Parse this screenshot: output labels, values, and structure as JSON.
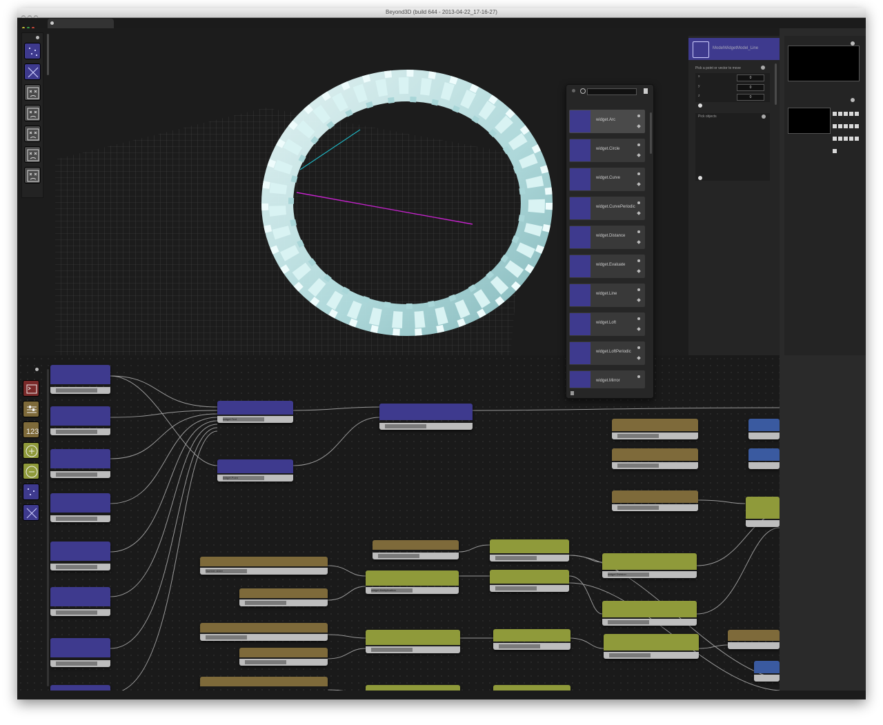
{
  "window": {
    "title": "Beyond3D (build 644 - 2013-04-22_17-16-27)"
  },
  "viewport": {
    "tools": [
      "points-tool-icon",
      "line-tool-icon",
      "widget-icon",
      "widget-icon",
      "widget-icon",
      "widget-icon",
      "widget-icon"
    ]
  },
  "widget_list": {
    "items": [
      {
        "label": "widget.Arc"
      },
      {
        "label": "widget.Circle"
      },
      {
        "label": "widget.Curve"
      },
      {
        "label": "widget.CurvePeriodic"
      },
      {
        "label": "widget.Distance"
      },
      {
        "label": "widget.Evaluate"
      },
      {
        "label": "widget.Line"
      },
      {
        "label": "widget.Loft"
      },
      {
        "label": "widget.LoftPeriodic"
      },
      {
        "label": "widget.Mirror"
      }
    ]
  },
  "inspector": {
    "title": "ModelWidgetModel_Line",
    "pick_point_label": "Pick a point or vector to move",
    "axes": [
      "x",
      "y",
      "z"
    ],
    "axis_values": [
      "0",
      "0",
      "0"
    ],
    "pick_objects_label": "Pick objects"
  },
  "graph": {
    "nodes": [
      {
        "name": "widget.Text"
      },
      {
        "name": "widget.Point"
      },
      {
        "name": "Number slider"
      },
      {
        "name": "widget.Multiplication"
      },
      {
        "name": "widget.Division"
      }
    ]
  },
  "colors": {
    "accent_purple": "#3e3a8e",
    "node_gold": "#7e6a3a",
    "node_olive": "#8f9a3a",
    "wire": "#9a9a9a"
  }
}
